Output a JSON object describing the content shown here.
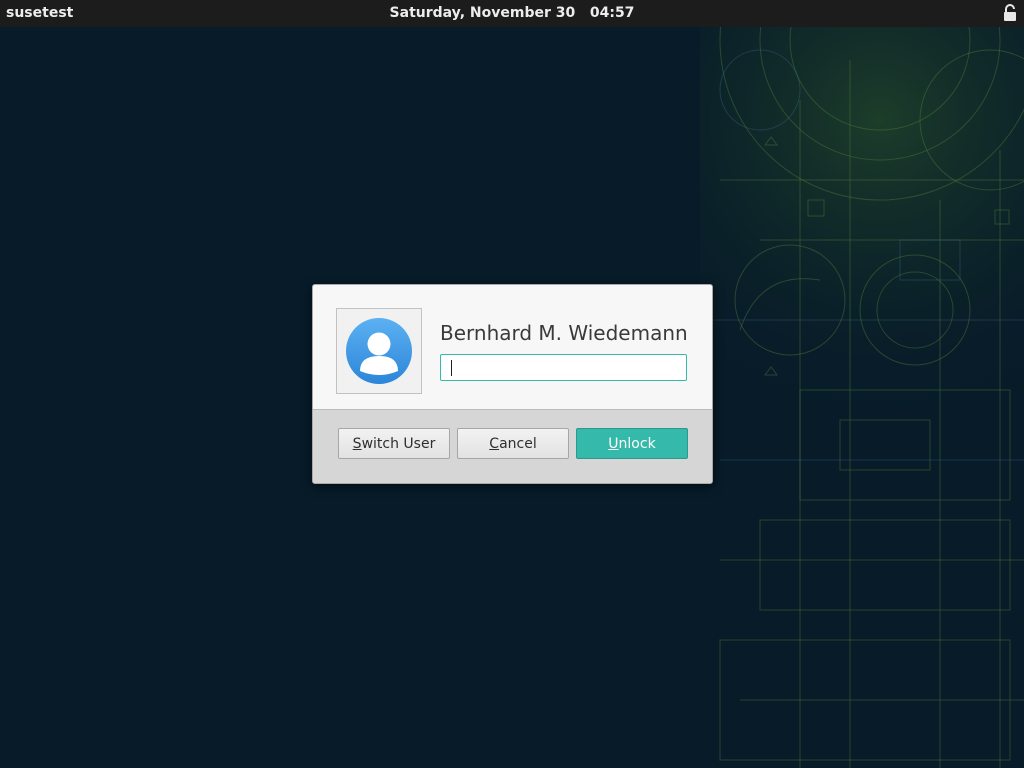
{
  "topbar": {
    "hostname": "susetest",
    "date": "Saturday, November 30",
    "time": "04:57",
    "lock_icon": "lock-icon"
  },
  "dialog": {
    "user_name": "Bernhard M. Wiedemann",
    "avatar_icon": "user-avatar-icon",
    "password_value": "",
    "buttons": {
      "switch_user": {
        "mnemonic": "S",
        "rest": "witch User"
      },
      "cancel": {
        "mnemonic": "C",
        "rest": "ancel"
      },
      "unlock": {
        "mnemonic": "U",
        "rest": "nlock"
      }
    }
  },
  "colors": {
    "accent": "#35b9ab",
    "background": "#071b29",
    "topbar": "#1c1c1c"
  }
}
